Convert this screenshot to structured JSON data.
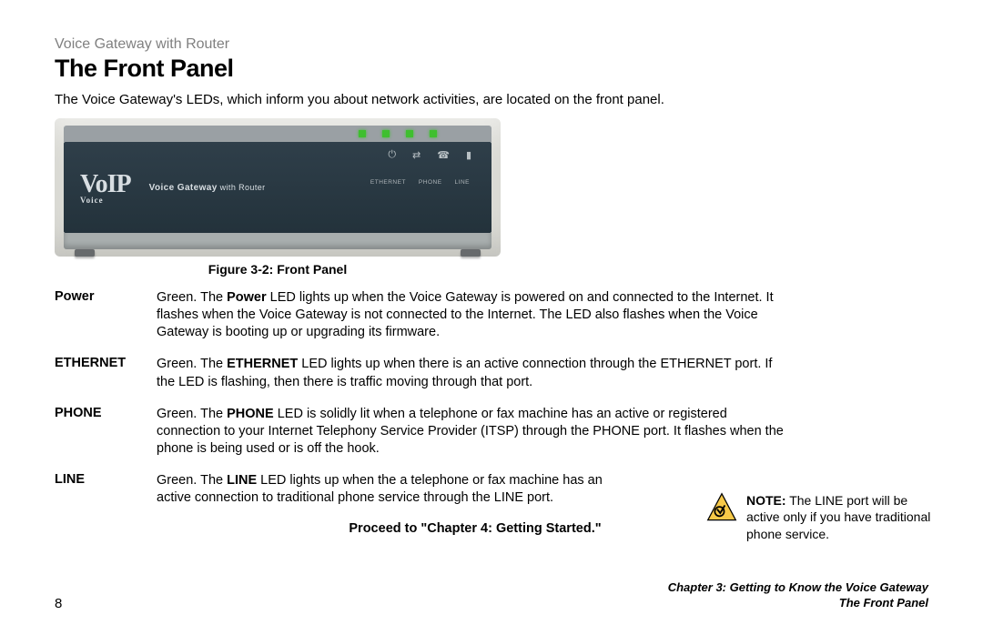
{
  "series_title": "Voice Gateway with Router",
  "heading": "The Front Panel",
  "intro": "The Voice Gateway's LEDs, which inform you about network activities, are located on the front panel.",
  "device": {
    "logo_main": "VoIP",
    "logo_small": "Voice",
    "subtitle_bold": "Voice Gateway",
    "subtitle_thin": " with Router",
    "port_labels": [
      "ETHERNET",
      "PHONE",
      "LINE"
    ]
  },
  "figure_caption": "Figure 3-2: Front Panel",
  "definitions": [
    {
      "term": "Power",
      "pre": "Green. The ",
      "bold": "Power",
      "post": " LED lights up when the Voice Gateway is powered on and connected to the Internet. It flashes when the Voice Gateway is not connected to the Internet. The LED also flashes when the Voice Gateway is booting up or upgrading its firmware."
    },
    {
      "term": "ETHERNET",
      "pre": "Green. The ",
      "bold": "ETHERNET",
      "post": " LED lights up when there is an active connection through the ETHERNET port. If the LED is flashing, then there is traffic moving through that port."
    },
    {
      "term": "PHONE",
      "pre": "Green. The ",
      "bold": "PHONE",
      "post": " LED is solidly lit when a telephone or fax machine has an active or registered connection to your Internet Telephony Service Provider (ITSP) through the PHONE port. It flashes when the phone is being used or is off the hook."
    },
    {
      "term": "LINE",
      "pre": "Green. The ",
      "bold": "LINE",
      "post": " LED lights up when the a telephone or fax machine has an active connection to traditional phone service through the LINE port."
    }
  ],
  "proceed": "Proceed to \"Chapter 4: Getting Started.\"",
  "note": {
    "label": "NOTE:",
    "text": "  The LINE port will be active only if you have traditional phone service."
  },
  "footer": {
    "page_number": "8",
    "chapter": "Chapter 3: Getting to Know the Voice Gateway",
    "section": "The Front Panel"
  },
  "icons": {
    "power": "⏻",
    "ethernet": "⇄",
    "phone": "☎",
    "line": "▮"
  }
}
